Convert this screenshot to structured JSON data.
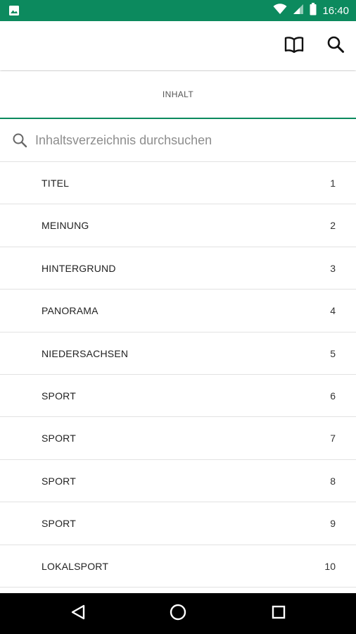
{
  "status_bar": {
    "time": "16:40",
    "icons": [
      "image-notification-icon",
      "wifi-icon",
      "signal-icon",
      "battery-icon"
    ]
  },
  "toolbar": {
    "icons": [
      "book-icon",
      "search-icon"
    ]
  },
  "tab": {
    "label": "INHALT"
  },
  "search": {
    "placeholder": "Inhaltsverzeichnis durchsuchen",
    "value": ""
  },
  "toc": {
    "items": [
      {
        "title": "TITEL",
        "page": "1"
      },
      {
        "title": "MEINUNG",
        "page": "2"
      },
      {
        "title": "HINTERGRUND",
        "page": "3"
      },
      {
        "title": "PANORAMA",
        "page": "4"
      },
      {
        "title": "NIEDERSACHSEN",
        "page": "5"
      },
      {
        "title": "SPORT",
        "page": "6"
      },
      {
        "title": "SPORT",
        "page": "7"
      },
      {
        "title": "SPORT",
        "page": "8"
      },
      {
        "title": "SPORT",
        "page": "9"
      },
      {
        "title": "LOKALSPORT",
        "page": "10"
      }
    ]
  },
  "nav_bar": {
    "icons": [
      "back-icon",
      "home-icon",
      "recents-icon"
    ]
  },
  "colors": {
    "accent": "#0c8a5e",
    "divider": "#e2e2e2",
    "nav_background": "#000000"
  }
}
